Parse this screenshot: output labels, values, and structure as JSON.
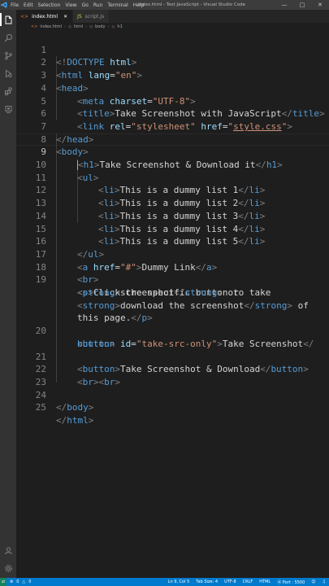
{
  "titlebar": {
    "menu": [
      "File",
      "Edit",
      "Selection",
      "View",
      "Go",
      "Run",
      "Terminal",
      "Help"
    ],
    "window_title": "index.html - Test JavaScript - Visual Studio Code"
  },
  "tabs": [
    {
      "label": "index.html",
      "icon": "html-file-icon",
      "active": true
    },
    {
      "label": "script.js",
      "icon": "js-file-icon",
      "active": false
    }
  ],
  "breadcrumb": [
    "index.html",
    "html",
    "body",
    "h1"
  ],
  "editor": {
    "current_line": 9,
    "line_numbers": [
      "1",
      "2",
      "3",
      "4",
      "5",
      "6",
      "7",
      "8",
      "9",
      "10",
      "11",
      "12",
      "13",
      "14",
      "15",
      "16",
      "17",
      "18",
      "19",
      "20",
      "21",
      "22",
      "23",
      "24",
      "25"
    ],
    "tokens": {
      "doctype": "DOCTYPE",
      "html": "html",
      "head": "head",
      "meta": "meta",
      "title": "title",
      "link": "link",
      "body": "body",
      "h1": "h1",
      "ul": "ul",
      "li": "li",
      "a": "a",
      "br": "br",
      "p": "p",
      "strong": "strong",
      "button": "button",
      "attr_lang": "lang",
      "attr_charset": "charset",
      "attr_rel": "rel",
      "attr_href": "href",
      "attr_id": "id",
      "val_en": "\"en\"",
      "val_utf8": "\"UTF-8\"",
      "val_stylesheet": "\"stylesheet\"",
      "val_stylecss_q": "\"",
      "val_stylecss": "style.css",
      "val_hash": "\"#\"",
      "val_take_src_only": "\"take-src-only\""
    },
    "text": {
      "title": "Take Screenshot with JavaScript",
      "h1": "Take Screenshot & Download it",
      "li1": "This is a dummy list 1",
      "li2": "This is a dummy list 2",
      "li3": "This is a dummy list 3",
      "li4": "This is a dummy list 4",
      "li5": "This is a dummy list 5",
      "link": "Dummy Link",
      "p1": "Click the specific button to take",
      "strong1": "screenshot",
      "or": " or",
      "strong2": "download the screenshot",
      "of": " of",
      "p_end": "this page.",
      "btn1": "Take Screenshot",
      "btn2": "Take Screenshot & Download"
    }
  },
  "statusbar": {
    "remote_icon": "remote-icon",
    "errors": "0",
    "warnings": "0",
    "position": "Ln 9, Col 5",
    "tab_size": "Tab Size: 4",
    "encoding": "UTF-8",
    "eol": "CRLF",
    "language": "HTML",
    "port": "Port : 5500"
  }
}
